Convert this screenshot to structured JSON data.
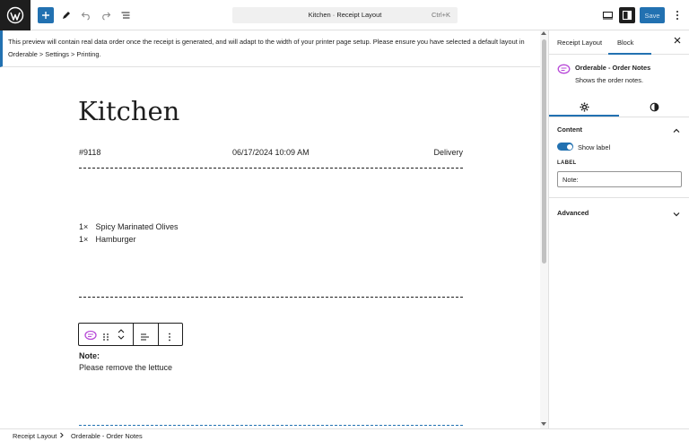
{
  "toolbar": {
    "add_icon": "plus-icon",
    "tools_icon": "pencil-icon",
    "undo_icon": "undo-icon",
    "redo_icon": "redo-icon",
    "outline_icon": "document-overview-icon",
    "command_title": "Kitchen · Receipt Layout",
    "command_shortcut": "Ctrl+K",
    "view_icon": "desktop-icon",
    "settings_icon": "sidebar-icon",
    "save_label": "Save",
    "more_icon": "more-vertical-icon"
  },
  "notice": {
    "text": "This preview will contain real data order once the receipt is generated, and will adapt to the width of your printer page setup. Please ensure you have selected a default layout in Orderable > Settings > Printing."
  },
  "receipt": {
    "title": "Kitchen",
    "order_number": "#9118",
    "datetime": "06/17/2024 10:09 AM",
    "order_type": "Delivery",
    "items": [
      {
        "qty": "1×",
        "name": "Spicy Marinated Olives"
      },
      {
        "qty": "1×",
        "name": "Hamburger"
      }
    ],
    "note_label": "Note:",
    "note_text": "Please remove the lettuce"
  },
  "block_toolbar": {
    "block_icon": "order-notes-icon",
    "drag_icon": "drag-handle-icon",
    "move_icon": "move-up-down-icon",
    "align_icon": "align-left-icon",
    "options_icon": "more-vertical-icon"
  },
  "sidebar": {
    "tabs": [
      "Receipt Layout",
      "Block"
    ],
    "active_tab": "Block",
    "close_icon": "close-icon",
    "block_name": "Orderable - Order Notes",
    "block_description": "Shows the order notes.",
    "subtab_icons": [
      "gear-icon",
      "styles-icon"
    ],
    "content_heading": "Content",
    "show_label_text": "Show label",
    "show_label_on": true,
    "label_field_title": "LABEL",
    "label_field_value": "Note:",
    "advanced_heading": "Advanced"
  },
  "breadcrumb": {
    "items": [
      "Receipt Layout",
      "Orderable - Order Notes"
    ]
  },
  "colors": {
    "accent": "#2271b1",
    "dark": "#1e1e1e",
    "block_icon": "#b84bd8"
  }
}
